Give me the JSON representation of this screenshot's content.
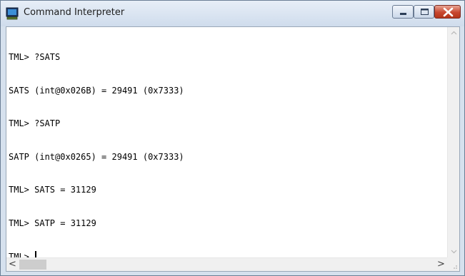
{
  "window": {
    "title": "Command Interpreter",
    "icon": "terminal-monitor-icon",
    "buttons": [
      "minimize",
      "maximize",
      "close"
    ]
  },
  "console": {
    "lines": [
      "TML> ?SATS",
      "SATS (int@0x026B) = 29491 (0x7333)",
      "TML> ?SATP",
      "SATP (int@0x0265) = 29491 (0x7333)",
      "TML> SATS = 31129",
      "TML> SATP = 31129"
    ],
    "prompt": "TML> "
  },
  "scrollbars": {
    "vertical": {
      "up_icon": "chevron-up-icon",
      "down_icon": "chevron-down-icon"
    },
    "horizontal": {
      "left_glyph": "<",
      "right_glyph": ">"
    }
  },
  "colors": {
    "close_button": "#c8472f",
    "titlebar": "#d6e1ee",
    "console_bg": "#ffffff",
    "console_text": "#000000"
  }
}
